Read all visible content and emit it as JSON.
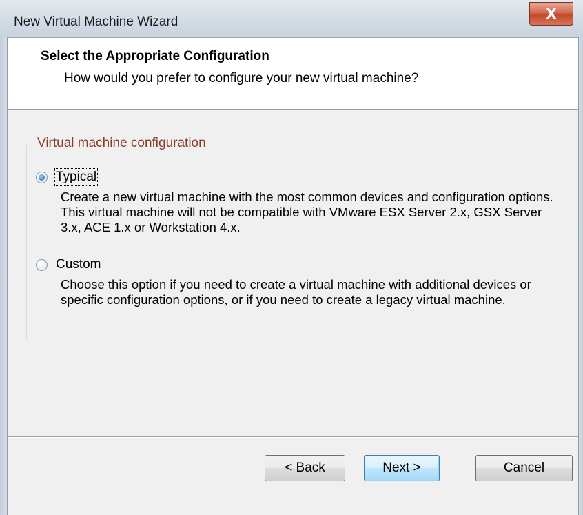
{
  "window": {
    "title": "New Virtual Machine Wizard",
    "close_label": "X"
  },
  "header": {
    "title": "Select the Appropriate Configuration",
    "subtitle": "How would you prefer to configure your new virtual machine?"
  },
  "group": {
    "legend": "Virtual machine configuration",
    "options": [
      {
        "label": "Typical",
        "selected": true,
        "description": "Create a new virtual machine with the most common devices and configuration options. This virtual machine will not be compatible with VMware ESX Server 2.x, GSX Server 3.x, ACE 1.x or Workstation 4.x."
      },
      {
        "label": "Custom",
        "selected": false,
        "description": "Choose this option if you need to create a virtual machine with additional devices or specific configuration options, or if you need to create a legacy virtual machine."
      }
    ]
  },
  "buttons": {
    "back": "< Back",
    "next": "Next >",
    "cancel": "Cancel"
  },
  "colors": {
    "legend": "#8b3a2a",
    "close_button": "#c04a2c",
    "default_button_border": "#3c7fb1"
  }
}
